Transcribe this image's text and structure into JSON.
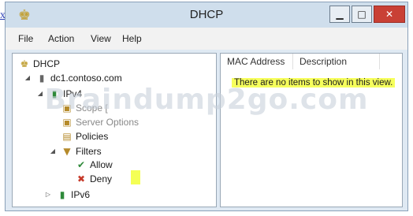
{
  "stray_text": "x",
  "window": {
    "title": "DHCP"
  },
  "menu": [
    "File",
    "Action",
    "View",
    "Help"
  ],
  "tree": {
    "root": "DHCP",
    "server": "dc1.contoso.com",
    "ipv4": "IPv4",
    "obscured_1": "Scope [",
    "obscured_2": "Server Options",
    "policies": "Policies",
    "filters": "Filters",
    "allow": "Allow",
    "deny": "Deny",
    "ipv6": "IPv6"
  },
  "list": {
    "columns": [
      "MAC Address",
      "Description"
    ],
    "empty_message": "There are no items to show in this view."
  },
  "watermark": "Braindump2go.com",
  "colors": {
    "highlight": "#f6ff5c",
    "close_button": "#c94035",
    "title_bar": "#cfdeec"
  }
}
